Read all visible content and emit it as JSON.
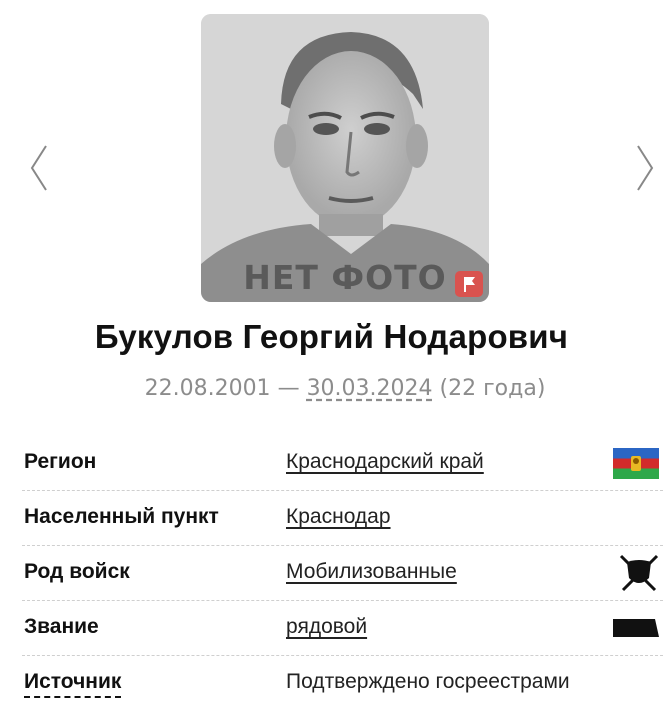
{
  "photo": {
    "placeholder_text": "НЕТ ФОТО"
  },
  "person": {
    "name": "Букулов Георгий Нодарович",
    "birth_date": "22.08.2001",
    "dash": "—",
    "death_date": "30.03.2024",
    "age": "(22 года)"
  },
  "details": [
    {
      "label": "Регион",
      "value": "Краснодарский край",
      "icon": "krasnodar-flag-icon"
    },
    {
      "label": "Населенный пункт",
      "value": "Краснодар"
    },
    {
      "label": "Род войск",
      "value": "Мобилизованные",
      "icon": "shield-swords-icon"
    },
    {
      "label": "Звание",
      "value": "рядовой",
      "icon": "rank-stripe-icon"
    },
    {
      "label": "Источник",
      "value": "Подтверждено госреестрами"
    }
  ],
  "colors": {
    "accent_red": "#d9534f",
    "muted_text": "#8c8c8c",
    "flag_blue": "#2b66c4",
    "flag_green": "#2ea84a",
    "flag_red": "#d22b2b"
  }
}
